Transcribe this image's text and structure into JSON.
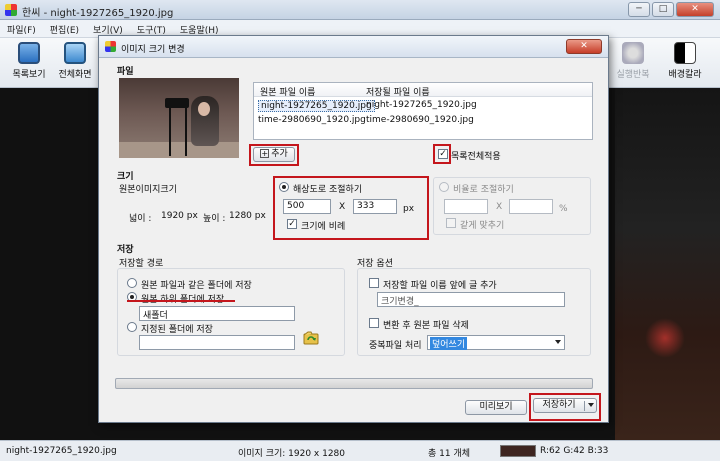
{
  "app": {
    "title": "한씨 - night-1927265_1920.jpg",
    "menu": [
      "파일(F)",
      "편집(E)",
      "보기(V)",
      "도구(T)",
      "도움말(H)"
    ],
    "toolbar": {
      "list_view": "목록보기",
      "fullscreen": "전체화면",
      "batch_rotate": "실행반복",
      "bg_color": "배경칼라"
    },
    "window_buttons": {
      "minimize": "─",
      "maximize": "□",
      "close": "✕"
    }
  },
  "dialog": {
    "title": "이미지 크기 변경",
    "close_glyph": "✕",
    "file_section": {
      "label": "파일",
      "columns": [
        "원본 파일 이름",
        "저장될 파일 이름"
      ],
      "rows": [
        {
          "source": "night-1927265_1920.jpg",
          "target": "night-1927265_1920.jpg"
        },
        {
          "source": "time-2980690_1920.jpg",
          "target": "time-2980690_1920.jpg"
        }
      ],
      "add_button": "추가",
      "add_icon_glyph": "+",
      "apply_all_label": "목록전체적용",
      "apply_all_checked": true
    },
    "size_section": {
      "label": "크기",
      "original_label": "원본이미지크기",
      "width_label": "넓이 :",
      "width_value": "1920 px",
      "height_label": "높이 :",
      "height_value": "1280 px",
      "by_resolution_label": "해상도로 조절하기",
      "res_width": "500",
      "res_height": "333",
      "x_label": "X",
      "px_unit": "px",
      "keep_ratio_label": "크기에 비례",
      "keep_ratio_checked": true,
      "by_percent_label": "비율로 조절하기",
      "pct_x_label": "X",
      "pct_unit": "%",
      "same_fit_label": "같게 맞추기"
    },
    "save_section": {
      "label": "저장",
      "path_label": "저장할 경로",
      "same_folder_label": "원본 파일과 같은 폴더에 저장",
      "subfolder_label": "원본 하위 폴더에 저장",
      "subfolder_name": "새폴더",
      "custom_folder_label": "지정된 폴더에 저장",
      "custom_folder_value": "",
      "options_label": "저장 옵션",
      "prefix_label": "저장할 파일 이름 앞에 글 추가",
      "prefix_value": "크기변경_",
      "delete_original_label": "변환 후 원본 파일 삭제",
      "duplicate_label": "중복파일 처리",
      "duplicate_value": "덮어쓰기"
    },
    "buttons": {
      "preview": "미리보기",
      "save": "저장하기"
    }
  },
  "status": {
    "filename": "night-1927265_1920.jpg",
    "image_size": "이미지 크기: 1920 x 1280",
    "count": "총 11 개체",
    "rgb": "R:62 G:42 B:33",
    "swatch_color": "#3e2520"
  },
  "colors": {
    "highlight_red": "#c4161c",
    "selection_blue": "#3388e0"
  }
}
